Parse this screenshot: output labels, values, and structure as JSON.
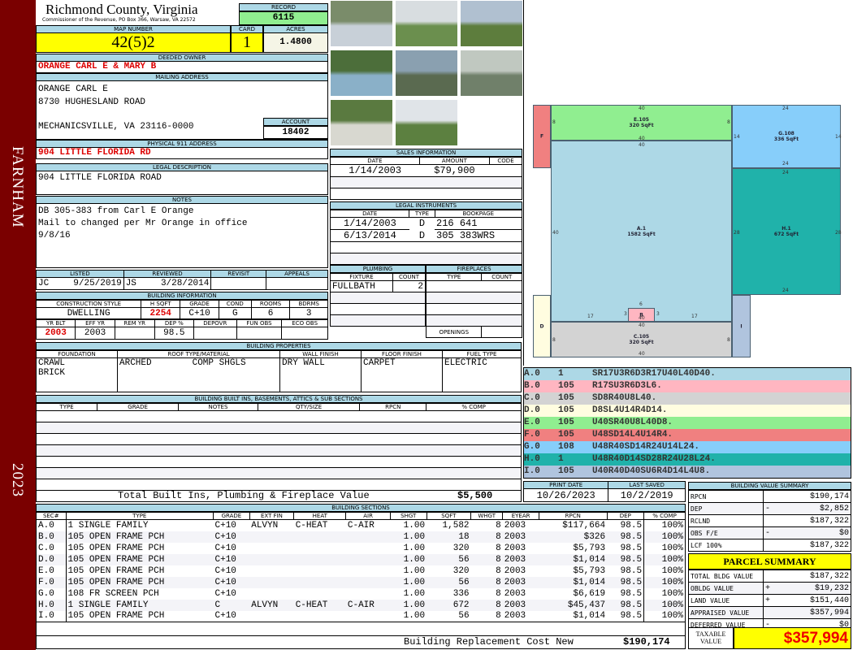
{
  "banner": {
    "district": "FARNHAM",
    "year": "2023"
  },
  "header": {
    "title": "Richmond County, Virginia",
    "subtitle": "Commissioner of the Revenue, PO Box 366, Warsaw, VA 22572",
    "record_label": "RECORD",
    "record": "6115"
  },
  "map": {
    "map_label": "MAP NUMBER",
    "map_number": "42(5)2",
    "card_label": "CARD",
    "card": "1",
    "acres_label": "ACRES",
    "acres": "1.4800"
  },
  "owner": {
    "label": "DEEDED OWNER",
    "value": "ORANGE CARL E & MARY B"
  },
  "mailing": {
    "label": "MAILING ADDRESS",
    "line1": "ORANGE CARL E",
    "line2": "8730 HUGHESLAND ROAD",
    "line3": "MECHANICSVILLE, VA 23116-0000",
    "account_label": "ACCOUNT",
    "account": "18402"
  },
  "physical": {
    "label": "PHYSICAL 911 ADDRESS",
    "value": "904 LITTLE FLORIDA RD"
  },
  "legal": {
    "label": "LEGAL DESCRIPTION",
    "value": "904 LITTLE FLORIDA ROAD"
  },
  "notes": {
    "label": "NOTES",
    "line1": "DB 305-383 from Carl E Orange",
    "line2": "Mail to changed per Mr Orange in office",
    "line3": "9/8/16"
  },
  "listing": {
    "listed_label": "LISTED",
    "listed_by": "JC",
    "listed_date": "9/25/2019",
    "reviewed_label": "REVIEWED",
    "reviewed_by": "JS",
    "reviewed_date": "3/28/2014",
    "revisit_label": "REVISIT",
    "appeals_label": "APPEALS"
  },
  "building_info": {
    "label": "BUILDING INFORMATION",
    "h": [
      "CONSTRUCTION STYLE",
      "H SQFT",
      "GRADE",
      "COND",
      "ROOMS",
      "BDRMS"
    ],
    "v": [
      "DWELLING",
      "2254",
      "C+10",
      "G",
      "6",
      "3"
    ],
    "h2": [
      "YR BLT",
      "EFF YR",
      "REM YR",
      "DEP %",
      "DEPOVR",
      "FUN OBS",
      "ECO OBS"
    ],
    "v2": [
      "2003",
      "2003",
      "",
      "98.5",
      "",
      "",
      ""
    ]
  },
  "properties": {
    "label": "BUILDING PROPERTIES",
    "h": [
      "FOUNDATION",
      "ROOF TYPE/MATERIAL",
      "WALL FINISH",
      "FLOOR FINISH",
      "FUEL TYPE"
    ],
    "foundation1": "CRAWL",
    "foundation2": "BRICK",
    "roof1": "ARCHED",
    "roof2": "COMP SHGLS",
    "wall": "DRY WALL",
    "floor": "CARPET",
    "fuel": "ELECTRIC"
  },
  "builtins": {
    "label": "BUILDING BUILT INS, BASEMENTS, ATTICS & SUB SECTIONS",
    "h": [
      "TYPE",
      "GRADE",
      "NOTES",
      "QTY/SIZE",
      "RPCN",
      "% COMP"
    ],
    "total_label": "Total Built Ins, Plumbing & Fireplace Value",
    "total": "$5,500"
  },
  "sales": {
    "label": "SALES INFORMATION",
    "h": [
      "DATE",
      "AMOUNT",
      "CODE"
    ],
    "rows": [
      [
        "1/14/2003",
        "$79,900",
        ""
      ]
    ]
  },
  "instruments": {
    "label": "LEGAL INSTRUMENTS",
    "h": [
      "DATE",
      "TYPE",
      "BOOKPAGE"
    ],
    "rows": [
      [
        "1/14/2003",
        "D",
        "216 641"
      ],
      [
        "6/13/2014",
        "D",
        "305 383WRS"
      ]
    ]
  },
  "plumbing": {
    "label": "PLUMBING",
    "h": [
      "FIXTURE",
      "COUNT"
    ],
    "fixture": "FULLBATH",
    "count": "2"
  },
  "fireplaces": {
    "label": "FIREPLACES",
    "h": [
      "TYPE",
      "COUNT"
    ],
    "openings": "OPENINGS"
  },
  "sketch": {
    "areas": [
      {
        "id": "A",
        "label": "A.1",
        "sqft": "1582 SqFt",
        "color": "#add8e6"
      },
      {
        "id": "B",
        "label": "B",
        "color": "#ffb6c1"
      },
      {
        "id": "C",
        "label": "C.105",
        "sqft": "320 SqFt",
        "color": "#d3d3d3"
      },
      {
        "id": "D",
        "label": "D",
        "color": "#fffde0"
      },
      {
        "id": "E",
        "label": "E.105",
        "sqft": "320 SqFt",
        "color": "#90ee90"
      },
      {
        "id": "F",
        "label": "F",
        "color": "#f08080"
      },
      {
        "id": "G",
        "label": "G.108",
        "sqft": "336 SqFt",
        "color": "#87cefa"
      },
      {
        "id": "H",
        "label": "H.1",
        "sqft": "672 SqFt",
        "color": "#20b2aa"
      },
      {
        "id": "I",
        "label": "I",
        "color": "#b0c4de"
      }
    ],
    "dims": [
      "40",
      "40",
      "40",
      "8",
      "8",
      "40",
      "40",
      "24",
      "14",
      "14",
      "24",
      "24",
      "28",
      "28",
      "24",
      "6",
      "3",
      "3",
      "17",
      "17",
      "40",
      "8",
      "8",
      "40"
    ]
  },
  "codes": [
    {
      "sec": "A.0",
      "type": "1",
      "code": "SR17U3R6D3R17U40L40D40.",
      "color": "#add8e6"
    },
    {
      "sec": "B.0",
      "type": "105",
      "code": "R17SU3R6D3L6.",
      "color": "#ffb6c1"
    },
    {
      "sec": "C.0",
      "type": "105",
      "code": "SD8R40U8L40.",
      "color": "#d3d3d3"
    },
    {
      "sec": "D.0",
      "type": "105",
      "code": "D8SL4U14R4D14.",
      "color": "#fffde0"
    },
    {
      "sec": "E.0",
      "type": "105",
      "code": "U40SR40U8L40D8.",
      "color": "#90ee90"
    },
    {
      "sec": "F.0",
      "type": "105",
      "code": "U48SD14L4U14R4.",
      "color": "#f08080"
    },
    {
      "sec": "G.0",
      "type": "108",
      "code": "U48R40SD14R24U14L24.",
      "color": "#87cefa"
    },
    {
      "sec": "H.0",
      "type": "1",
      "code": "U48R40D14SD28R24U28L24.",
      "color": "#20b2aa"
    },
    {
      "sec": "I.0",
      "type": "105",
      "code": "U40R40D40SU6R4D14L4U8.",
      "color": "#b0c4de"
    }
  ],
  "dates": {
    "print_label": "PRINT DATE",
    "print": "10/26/2023",
    "saved_label": "LAST SAVED",
    "saved": "10/2/2019"
  },
  "sections": {
    "label": "BUILDING SECTIONS",
    "h": [
      "SEC#",
      "TYPE",
      "GRADE",
      "EXT FIN",
      "HEAT",
      "AIR",
      "SHGT",
      "SQFT",
      "WHGT",
      "EYEAR",
      "RPCN",
      "DEP",
      "% COMP"
    ],
    "rows": [
      [
        "A.0",
        "1 SINGLE FAMILY",
        "C+10",
        "ALVYN",
        "C-HEAT",
        "C-AIR",
        "1.00",
        "1,582",
        "8",
        "2003",
        "$117,664",
        "98.5",
        "100%"
      ],
      [
        "B.0",
        "105 OPEN FRAME PCH",
        "C+10",
        "",
        "",
        "",
        "1.00",
        "18",
        "8",
        "2003",
        "$326",
        "98.5",
        "100%"
      ],
      [
        "C.0",
        "105 OPEN FRAME PCH",
        "C+10",
        "",
        "",
        "",
        "1.00",
        "320",
        "8",
        "2003",
        "$5,793",
        "98.5",
        "100%"
      ],
      [
        "D.0",
        "105 OPEN FRAME PCH",
        "C+10",
        "",
        "",
        "",
        "1.00",
        "56",
        "8",
        "2003",
        "$1,014",
        "98.5",
        "100%"
      ],
      [
        "E.0",
        "105 OPEN FRAME PCH",
        "C+10",
        "",
        "",
        "",
        "1.00",
        "320",
        "8",
        "2003",
        "$5,793",
        "98.5",
        "100%"
      ],
      [
        "F.0",
        "105 OPEN FRAME PCH",
        "C+10",
        "",
        "",
        "",
        "1.00",
        "56",
        "8",
        "2003",
        "$1,014",
        "98.5",
        "100%"
      ],
      [
        "G.0",
        "108 FR SCREEN PCH",
        "C+10",
        "",
        "",
        "",
        "1.00",
        "336",
        "8",
        "2003",
        "$6,619",
        "98.5",
        "100%"
      ],
      [
        "H.0",
        "1 SINGLE FAMILY",
        "C",
        "ALVYN",
        "C-HEAT",
        "C-AIR",
        "1.00",
        "672",
        "8",
        "2003",
        "$45,437",
        "98.5",
        "100%"
      ],
      [
        "I.0",
        "105 OPEN FRAME PCH",
        "C+10",
        "",
        "",
        "",
        "1.00",
        "56",
        "8",
        "2003",
        "$1,014",
        "98.5",
        "100%"
      ]
    ],
    "total_label": "Building Replacement Cost New",
    "total": "$190,174"
  },
  "value_summary": {
    "label": "BUILDING VALUE SUMMARY",
    "rows": [
      [
        "RPCN",
        "",
        "$190,174"
      ],
      [
        "DEP",
        "-",
        "$2,852"
      ],
      [
        "RCLND",
        "",
        "$187,322"
      ],
      [
        "OBS F/E",
        "-",
        "$0"
      ],
      [
        "LCF 100%",
        "",
        "$187,322"
      ]
    ]
  },
  "parcel": {
    "label": "PARCEL SUMMARY",
    "rows": [
      [
        "TOTAL BLDG VALUE",
        "",
        "$187,322"
      ],
      [
        "OBLDG VALUE",
        "+",
        "$19,232"
      ],
      [
        "LAND VALUE",
        "+",
        "$151,440"
      ],
      [
        "APPRAISED VALUE",
        "",
        "$357,994"
      ],
      [
        "DEFERRED VALUE",
        "-",
        "$0"
      ]
    ],
    "taxable_label": "TAXABLE VALUE",
    "taxable": "$357,994"
  }
}
